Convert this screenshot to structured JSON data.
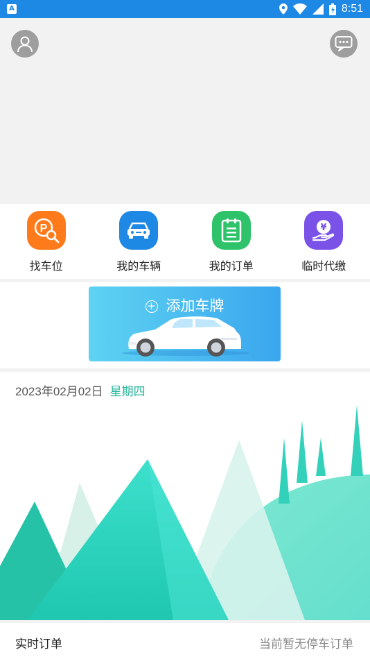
{
  "status_bar": {
    "left_badge": "A",
    "time": "8:51",
    "icons": [
      "location-icon",
      "wifi-icon",
      "signal-icon",
      "battery-icon"
    ]
  },
  "header": {
    "avatar_icon": "person-icon",
    "message_icon": "chat-bubble-icon"
  },
  "quick_menu": [
    {
      "label": "找车位",
      "icon": "parking-search-icon",
      "color": "#ff7a1a"
    },
    {
      "label": "我的车辆",
      "icon": "car-icon",
      "color": "#1e88e5"
    },
    {
      "label": "我的订单",
      "icon": "clipboard-icon",
      "color": "#2ec26a"
    },
    {
      "label": "临时代缴",
      "icon": "yen-hand-icon",
      "color": "#7b52e8"
    }
  ],
  "plate_card": {
    "title": "添加车牌",
    "icon": "plus-circle-icon"
  },
  "date_panel": {
    "date": "2023年02月02日",
    "weekday": "星期四"
  },
  "orders": {
    "title": "实时订单",
    "status": "当前暂无停车订单"
  },
  "colors": {
    "status_bar": "#1e88e5",
    "accent_green": "#26b59a"
  }
}
